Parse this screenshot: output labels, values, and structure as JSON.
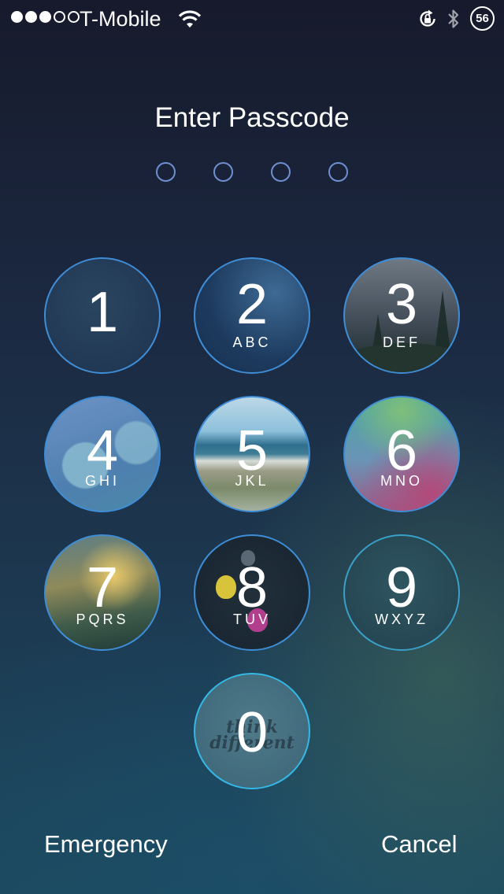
{
  "status_bar": {
    "signal_bars_filled": 3,
    "signal_bars_total": 5,
    "carrier": "T-Mobile",
    "wifi_icon": "wifi-icon",
    "rotation_lock_icon": "rotation-lock-icon",
    "bluetooth_icon": "bluetooth-icon",
    "battery_level": "56"
  },
  "passcode": {
    "title": "Enter Passcode",
    "dots_total": 4,
    "dots_filled": 0,
    "dot_color": "#6f8fd0"
  },
  "keypad": {
    "keys": [
      {
        "digit": "1",
        "letters": ""
      },
      {
        "digit": "2",
        "letters": "ABC"
      },
      {
        "digit": "3",
        "letters": "DEF"
      },
      {
        "digit": "4",
        "letters": "GHI"
      },
      {
        "digit": "5",
        "letters": "JKL"
      },
      {
        "digit": "6",
        "letters": "MNO"
      },
      {
        "digit": "7",
        "letters": "PQRS"
      },
      {
        "digit": "8",
        "letters": "TUV"
      },
      {
        "digit": "9",
        "letters": "WXYZ"
      },
      {
        "digit": "0",
        "letters": ""
      }
    ],
    "key0_background_text": [
      "think",
      "different"
    ],
    "key_border_color": "#3f8dd6"
  },
  "bottom": {
    "emergency_label": "Emergency",
    "cancel_label": "Cancel"
  }
}
